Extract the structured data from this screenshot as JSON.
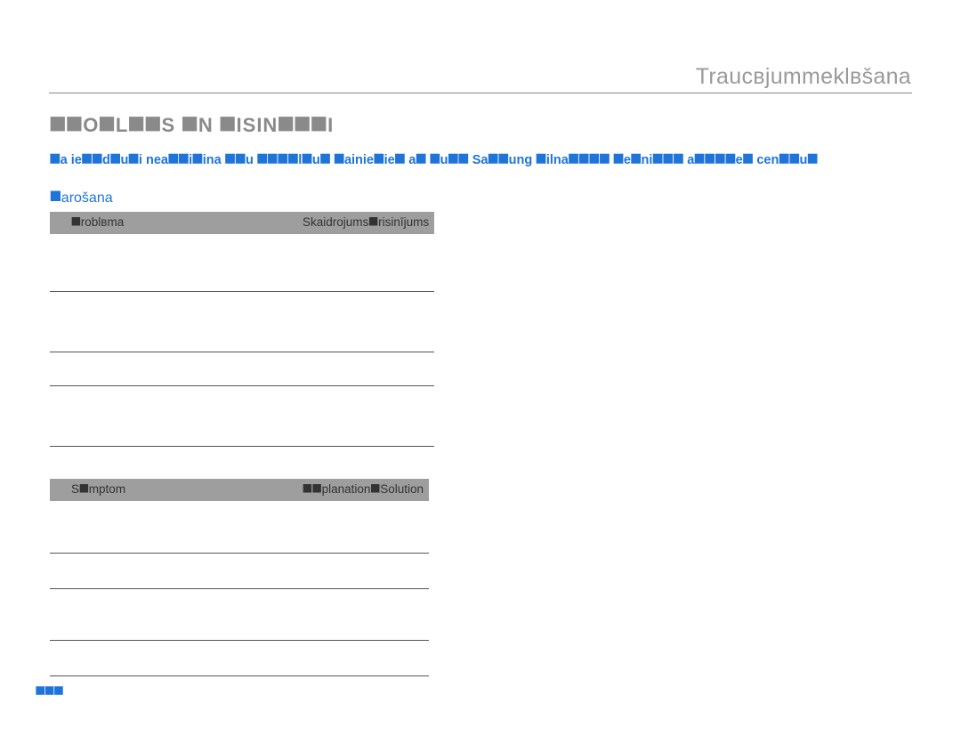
{
  "header": {
    "breadcrumb": "Traucвjummeklвšana"
  },
  "title": "⯀⯀O⯀L⯀⯀S ⯀N ⯀ISIN⯀⯀⯀I",
  "notice": "⯀a ie⯀⯀d⯀u⯀i nea⯀⯀i⯀ina ⯀⯀u ⯀⯀⯀⯀l⯀u⯀ ⯀ainie⯀ie⯀ a⯀ ⯀u⯀⯀ Sa⯀⯀ung ⯀ilna⯀⯀⯀⯀ ⯀e⯀ni⯀⯀⯀ a⯀⯀⯀⯀e⯀ cen⯀⯀u⯀",
  "section1": {
    "label": "⯀arošana",
    "columns": {
      "col1": "⯀roblвma",
      "col2": "Skaidrojums⯀risinījums"
    },
    "rows": [
      "",
      "",
      "",
      ""
    ]
  },
  "section2": {
    "columns": {
      "col1": "S⯀mptom",
      "col2": "⯀⯀planation⯀Solution"
    },
    "rows": [
      "",
      "",
      "",
      ""
    ]
  },
  "pageNumber": "⯀⯀⯀"
}
